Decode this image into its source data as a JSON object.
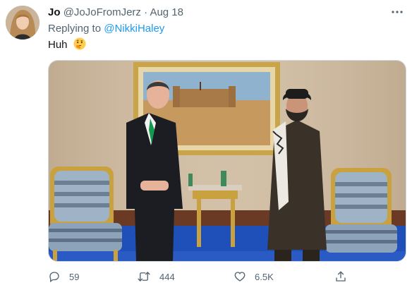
{
  "tweet": {
    "author_name": "Jo",
    "author_handle": "@JoJoFromJerz",
    "separator": "·",
    "date": "Aug 18",
    "replying_prefix": "Replying to",
    "replying_to": "@NikkiHaley",
    "text": "Huh",
    "emoji": "thinking-face"
  },
  "actions": {
    "replies": "59",
    "retweets": "444",
    "likes": "6.5K"
  },
  "colors": {
    "link": "#1d9bf0",
    "secondary_text": "#536471"
  },
  "icons": [
    "more-icon",
    "reply-icon",
    "retweet-icon",
    "like-icon",
    "share-icon"
  ]
}
